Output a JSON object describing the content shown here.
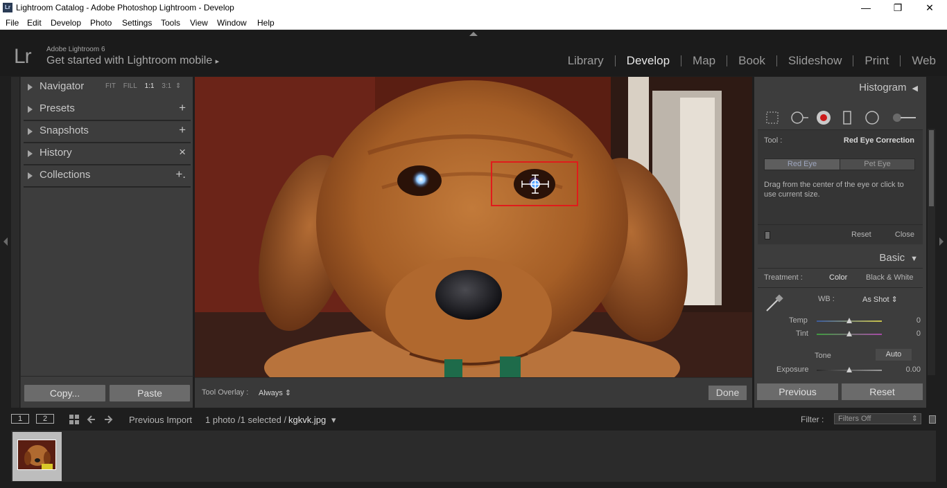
{
  "window": {
    "title": "Lightroom Catalog - Adobe Photoshop Lightroom - Develop",
    "app_icon": "Lr",
    "controls": {
      "minimize": "—",
      "maximize": "❐",
      "close": "✕"
    }
  },
  "menu": [
    "File",
    "Edit",
    "Develop",
    "Photo",
    "Settings",
    "Tools",
    "View",
    "Window",
    "Help"
  ],
  "identity": {
    "logo": "Lr",
    "line1": "Adobe Lightroom 6",
    "line2": "Get started with Lightroom mobile",
    "line2_arrow": "▸"
  },
  "modules": [
    {
      "label": "Library",
      "active": false
    },
    {
      "label": "Develop",
      "active": true
    },
    {
      "label": "Map",
      "active": false
    },
    {
      "label": "Book",
      "active": false
    },
    {
      "label": "Slideshow",
      "active": false
    },
    {
      "label": "Print",
      "active": false
    },
    {
      "label": "Web",
      "active": false
    }
  ],
  "left_panel": {
    "navigator": {
      "label": "Navigator",
      "zoom": [
        "FIT",
        "FILL",
        "1:1",
        "3:1"
      ],
      "zoom_active": "1:1",
      "zoom_arrow": "⇕"
    },
    "presets": {
      "label": "Presets",
      "action": "+"
    },
    "snapshots": {
      "label": "Snapshots",
      "action": "+"
    },
    "history": {
      "label": "History",
      "action": "×"
    },
    "collections": {
      "label": "Collections",
      "action": "+."
    },
    "copy_button": "Copy...",
    "paste_button": "Paste"
  },
  "toolbar": {
    "overlay_label": "Tool Overlay :",
    "overlay_value": "Always ⇕",
    "done_button": "Done"
  },
  "right_panel": {
    "histogram_title": "Histogram",
    "histogram_arrow": "◀",
    "tool": {
      "label": "Tool :",
      "value": "Red Eye Correction",
      "seg_red_eye": "Red Eye",
      "seg_pet_eye": "Pet Eye",
      "hint": "Drag from the center of the eye or click to use current size.",
      "reset": "Reset",
      "close": "Close"
    },
    "basic": {
      "title": "Basic",
      "arrow": "▼",
      "treatment_label": "Treatment :",
      "treatment_color": "Color",
      "treatment_bw": "Black & White",
      "wb_label": "WB :",
      "wb_value": "As Shot ⇕",
      "temp_label": "Temp",
      "temp_value": "0",
      "tint_label": "Tint",
      "tint_value": "0",
      "tone_label": "Tone",
      "auto_label": "Auto",
      "exposure_label": "Exposure",
      "exposure_value": "0.00"
    },
    "previous_button": "Previous",
    "reset_button": "Reset"
  },
  "filmstrip": {
    "monitor1": "1",
    "monitor2": "2",
    "source": "Previous Import",
    "count": "1 photo /1 selected /",
    "filename": "kgkvk.jpg",
    "filename_arrow": "▾",
    "filter_label": "Filter :",
    "filter_value": "Filters Off",
    "filter_arrow": "⇕"
  },
  "icons": {
    "grid": "grid-icon",
    "prev": "arrow-left-icon",
    "next": "arrow-right-icon",
    "eyedropper": "eyedropper-icon"
  },
  "colors": {
    "accent": "#e8e8e8",
    "redeye_box": "#e01b1b",
    "panel": "#3d3d3d"
  }
}
